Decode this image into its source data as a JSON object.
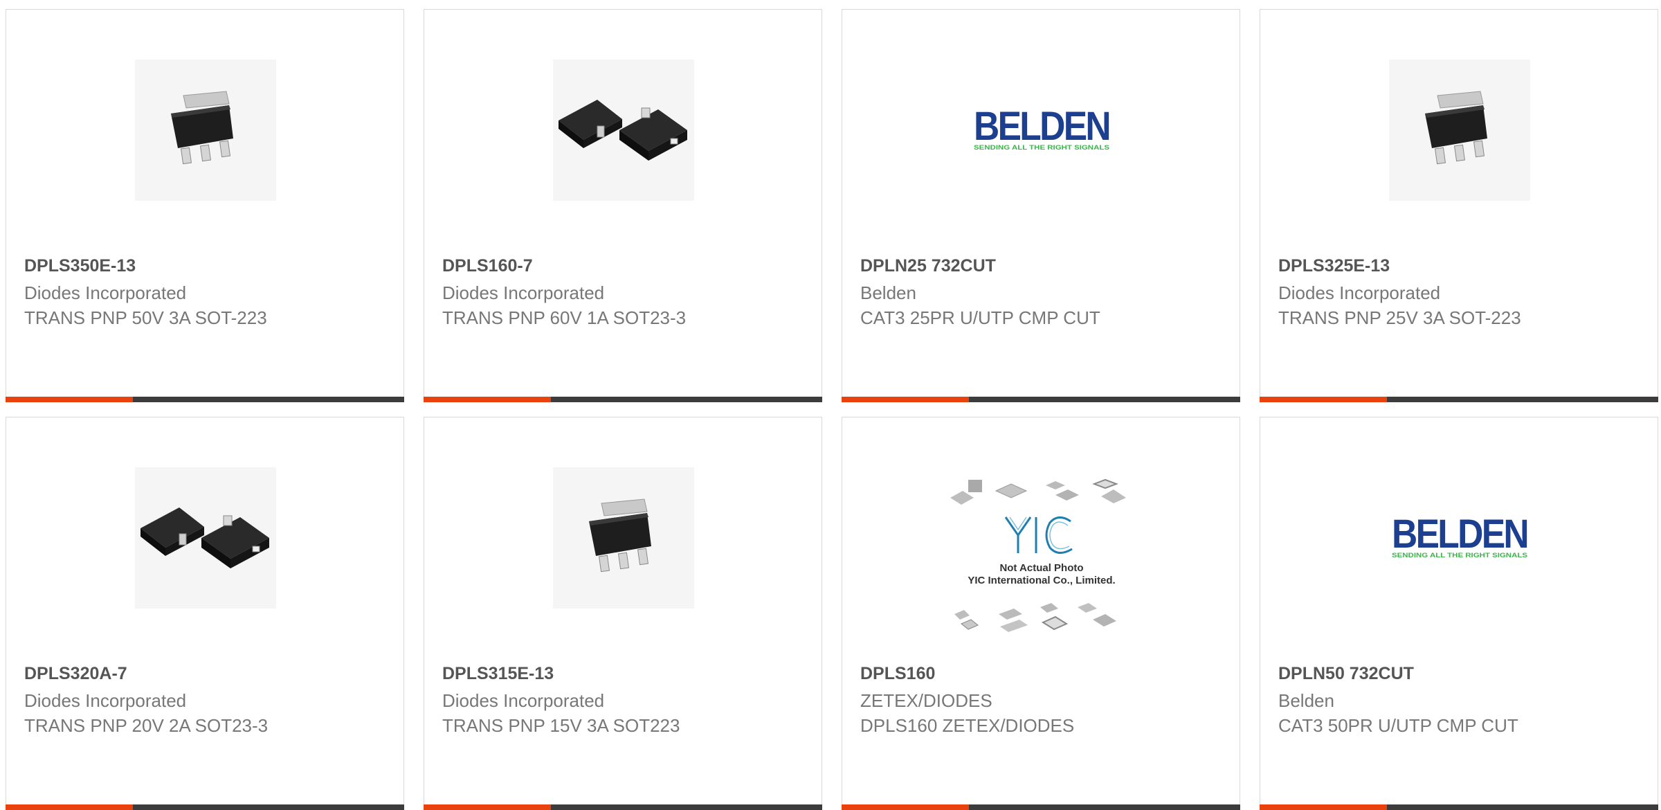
{
  "colors": {
    "accent": "#e8420e",
    "bar": "#3c3c3c",
    "title": "#555555",
    "text": "#777777",
    "border": "#d9d9d9",
    "belden_blue": "#1d3f8f",
    "belden_green": "#3ab54a"
  },
  "products": [
    {
      "part_number": "DPLS350E-13",
      "manufacturer": "Diodes Incorporated",
      "description": "TRANS PNP 50V 3A SOT-223",
      "image": "sot223-package"
    },
    {
      "part_number": "DPLS160-7",
      "manufacturer": "Diodes Incorporated",
      "description": "TRANS PNP 60V 1A SOT23-3",
      "image": "sot23-package"
    },
    {
      "part_number": "DPLN25 732CUT",
      "manufacturer": "Belden",
      "description": "CAT3 25PR U/UTP CMP CUT",
      "image": "belden-logo"
    },
    {
      "part_number": "DPLS325E-13",
      "manufacturer": "Diodes Incorporated",
      "description": "TRANS PNP 25V 3A SOT-223",
      "image": "sot223-package"
    },
    {
      "part_number": "DPLS320A-7",
      "manufacturer": "Diodes Incorporated",
      "description": "TRANS PNP 20V 2A SOT23-3",
      "image": "sot23-package"
    },
    {
      "part_number": "DPLS315E-13",
      "manufacturer": "Diodes Incorporated",
      "description": "TRANS PNP 15V 3A SOT223",
      "image": "sot223-package"
    },
    {
      "part_number": "DPLS160",
      "manufacturer": "ZETEX/DIODES",
      "description": "DPLS160 ZETEX/DIODES",
      "image": "yic-not-actual-photo"
    },
    {
      "part_number": "DPLN50 732CUT",
      "manufacturer": "Belden",
      "description": "CAT3 50PR U/UTP CMP CUT",
      "image": "belden-logo"
    }
  ],
  "belden_logo": {
    "wordmark": "BELDEN",
    "tagline": "SENDING ALL THE RIGHT SIGNALS"
  },
  "yic_image": {
    "logo": "YIC",
    "line1": "Not Actual Photo",
    "line2": "YIC International Co., Limited."
  }
}
